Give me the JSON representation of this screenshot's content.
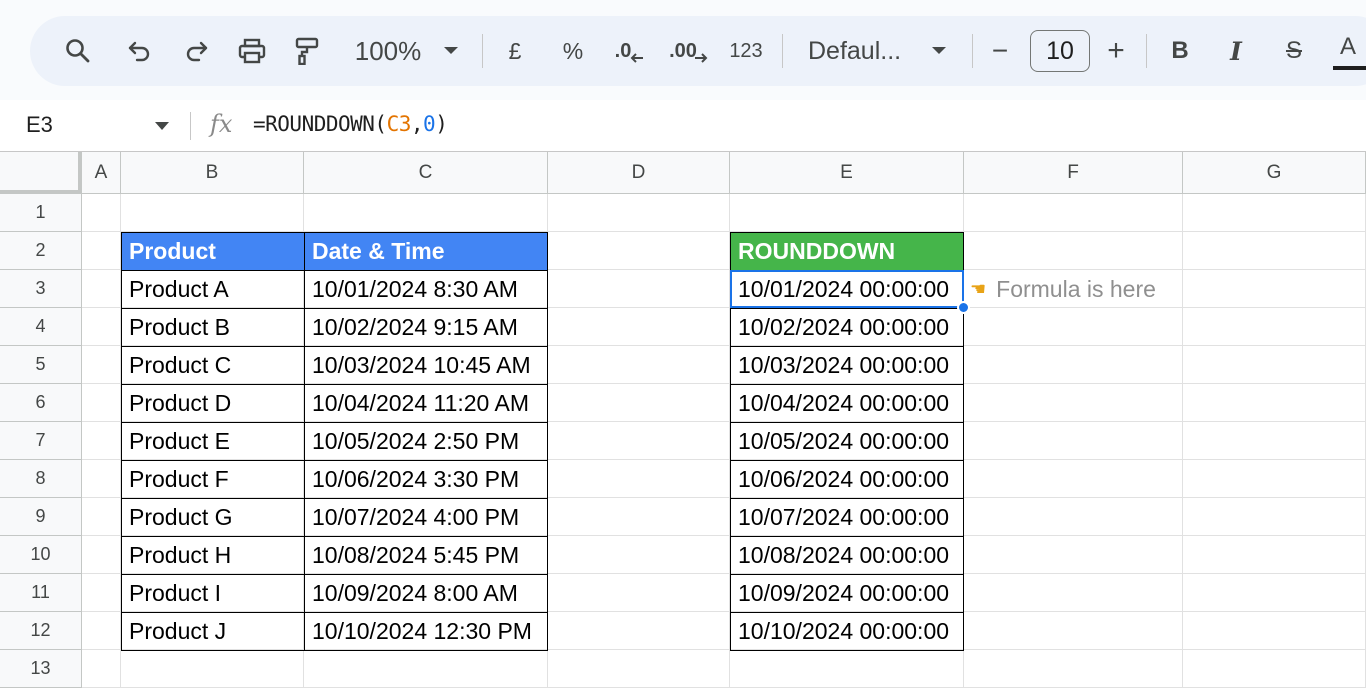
{
  "toolbar": {
    "zoom": "100%",
    "currency": "£",
    "percent": "%",
    "dec_decrease": ".0",
    "dec_increase": ".00",
    "number_format": "123",
    "font": "Defaul...",
    "minus": "−",
    "font_size": "10",
    "plus": "+",
    "bold": "B",
    "italic": "I",
    "strike": "S",
    "color_a": "A"
  },
  "formula_bar": {
    "cell_ref": "E3",
    "fx": "fx",
    "formula_prefix": "=ROUNDDOWN(",
    "formula_ref": "C3",
    "formula_comma": ",",
    "formula_arg": "0",
    "formula_suffix": ")",
    "ref_color": "#e37400",
    "arg_color": "#1a73e8"
  },
  "columns": [
    "A",
    "B",
    "C",
    "D",
    "E",
    "F",
    "G"
  ],
  "rows": [
    "1",
    "2",
    "3",
    "4",
    "5",
    "6",
    "7",
    "8",
    "9",
    "10",
    "11",
    "12",
    "13"
  ],
  "table": {
    "header_product": "Product",
    "header_datetime": "Date & Time",
    "header_rounddown": "ROUNDDOWN",
    "header_blue": "#4285f4",
    "header_green": "#45b54a",
    "products": [
      "Product A",
      "Product B",
      "Product C",
      "Product D",
      "Product E",
      "Product F",
      "Product G",
      "Product H",
      "Product I",
      "Product J"
    ],
    "datetimes": [
      "10/01/2024 8:30 AM",
      "10/02/2024 9:15 AM",
      "10/03/2024 10:45 AM",
      "10/04/2024 11:20 AM",
      "10/05/2024 2:50 PM",
      "10/06/2024 3:30 PM",
      "10/07/2024 4:00 PM",
      "10/08/2024 5:45 PM",
      "10/09/2024 8:00 AM",
      "10/10/2024 12:30 PM"
    ],
    "rounddown": [
      "10/01/2024 00:00:00",
      "10/02/2024 00:00:00",
      "10/03/2024 00:00:00",
      "10/04/2024 00:00:00",
      "10/05/2024 00:00:00",
      "10/06/2024 00:00:00",
      "10/07/2024 00:00:00",
      "10/08/2024 00:00:00",
      "10/09/2024 00:00:00",
      "10/10/2024 00:00:00"
    ]
  },
  "note": {
    "icon": "pointing-hand-icon",
    "text": "Formula is here"
  }
}
